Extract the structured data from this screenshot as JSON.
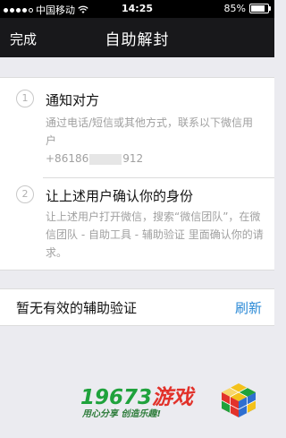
{
  "status_bar": {
    "carrier": "中国移动",
    "time": "14:25",
    "battery_percent": "85%",
    "battery_level": 0.85,
    "signal_bars_filled": 4,
    "signal_bars_total": 5
  },
  "nav": {
    "done_label": "完成",
    "title": "自助解封"
  },
  "steps": [
    {
      "number": "1",
      "title": "通知对方",
      "description": "通过电话/短信或其他方式，联系以下微信用户",
      "phone_prefix": "+86186",
      "phone_suffix": "912"
    },
    {
      "number": "2",
      "title": "让上述用户确认你的身份",
      "description": "让上述用户打开微信，搜索“微信团队”，在微信团队 - 自助工具 - 辅助验证 里面确认你的请求。"
    }
  ],
  "verify": {
    "status_label": "暂无有效的辅助验证",
    "refresh_label": "刷新"
  },
  "watermark": {
    "brand_number": "19673",
    "brand_text": "游戏",
    "slogan": "用心分享 创造乐趣!"
  },
  "colors": {
    "nav_background": "#18181b",
    "page_background": "#ebebf0",
    "link": "#2b8ad6",
    "watermark_green": "#1fa23c",
    "watermark_red": "#e2322b"
  }
}
